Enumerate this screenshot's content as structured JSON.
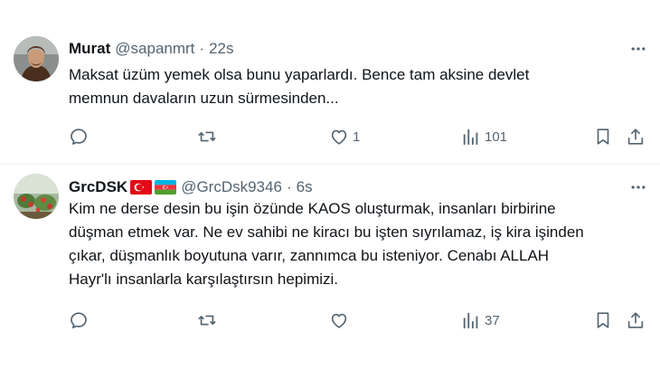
{
  "tweets": [
    {
      "name": "Murat",
      "handle": "@sapanmrt",
      "separator": "·",
      "time": "22s",
      "text": "Maksat üzüm yemek olsa bunu yaparlardı. Bence tam aksine devlet\nmemnun davaların uzun sürmesinden...",
      "reply_count": "",
      "retweet_count": "",
      "like_count": "1",
      "views_count": "101"
    },
    {
      "name": "GrcDSK",
      "flags": [
        "turkey-flag",
        "azerbaijan-flag"
      ],
      "handle": "@GrcDsk9346",
      "separator": "·",
      "time": "6s",
      "text": "Kim ne derse desin bu işin özünde KAOS oluşturmak, insanları birbirine\ndüşman etmek var. Ne ev sahibi ne kiracı bu işten sıyrılamaz, iş kira işinden\nçıkar, düşmanlık boyutuna varır, zannımca bu isteniyor. Cenabı ALLAH\nHayr'lı insanlarla karşılaştırsın hepimizi.",
      "reply_count": "",
      "retweet_count": "",
      "like_count": "",
      "views_count": "37"
    }
  ],
  "icons": [
    "more-icon",
    "reply-icon",
    "retweet-icon",
    "like-icon",
    "views-icon",
    "bookmark-icon",
    "share-icon"
  ],
  "colors": {
    "text": "#0f1419",
    "secondary": "#536471",
    "divider": "#eff3f4"
  }
}
